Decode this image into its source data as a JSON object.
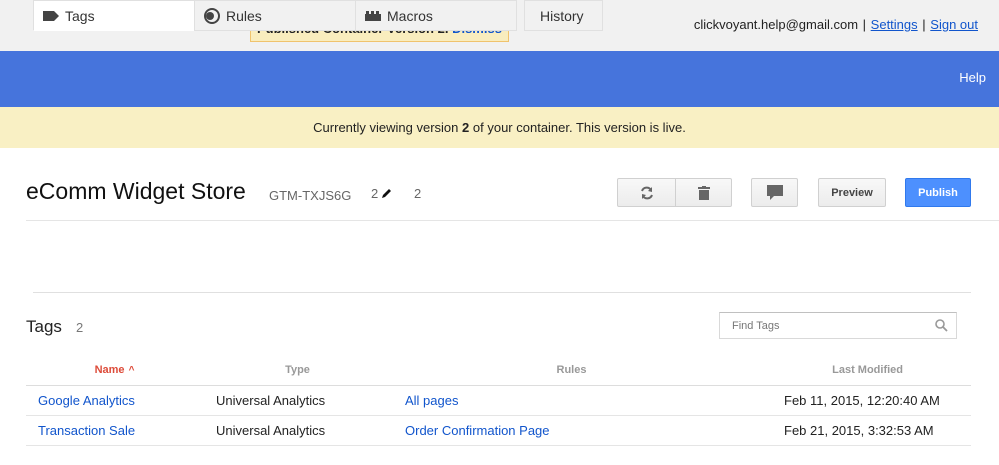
{
  "notice": {
    "text": "Published Container Version 2.",
    "dismiss_label": "Dismiss"
  },
  "account": {
    "email": "clickvoyant.help@gmail.com",
    "settings_label": "Settings",
    "signout_label": "Sign out",
    "separator": "|"
  },
  "header": {
    "help_label": "Help"
  },
  "version_bar": {
    "prefix": "Currently viewing version",
    "version": "2",
    "suffix": "of your container. This version is live."
  },
  "container": {
    "name": "eComm Widget Store",
    "id": "GTM-TXJS6G",
    "version": "2",
    "version_count": "2"
  },
  "toolbar": {
    "refresh_icon": "refresh-icon",
    "trash_icon": "trash-icon",
    "comment_icon": "comment-icon",
    "preview_label": "Preview",
    "publish_label": "Publish"
  },
  "tabs": [
    {
      "label": "Tags",
      "icon": "tag-icon",
      "active": true
    },
    {
      "label": "Rules",
      "icon": "rules-icon",
      "active": false
    },
    {
      "label": "Macros",
      "icon": "macros-icon",
      "active": false
    },
    {
      "label": "History",
      "icon": "",
      "active": false
    }
  ],
  "section": {
    "title": "Tags",
    "count": "2"
  },
  "search": {
    "placeholder": "Find Tags",
    "value": ""
  },
  "table": {
    "columns": {
      "name": "Name",
      "type": "Type",
      "rules": "Rules",
      "modified": "Last Modified"
    },
    "rows": [
      {
        "name": "Google Analytics",
        "type": "Universal Analytics",
        "rules": "All pages",
        "modified": "Feb 11, 2015, 12:20:40 AM"
      },
      {
        "name": "Transaction Sale",
        "type": "Universal Analytics",
        "rules": "Order Confirmation Page",
        "modified": "Feb 21, 2015, 3:32:53 AM"
      }
    ]
  },
  "colors": {
    "accent_blue": "#4674dc",
    "link": "#1155cc",
    "publish": "#4d90fe",
    "sort_red": "#dd4b39",
    "notice_bg": "#f9edbe",
    "version_bg": "#f9f0c4"
  }
}
